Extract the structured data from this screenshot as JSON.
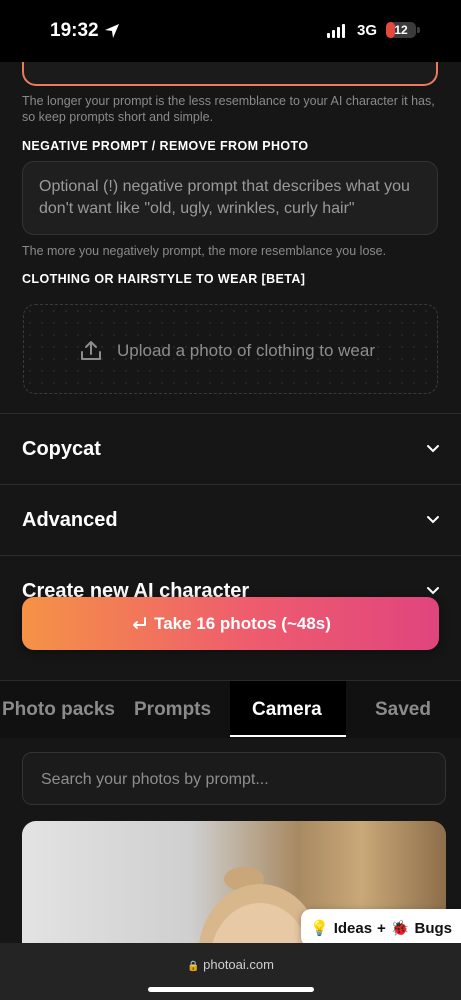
{
  "status_bar": {
    "time": "19:32",
    "network": "3G",
    "battery": "12",
    "battery_fraction": 0.12
  },
  "prompt_hint": "The longer your prompt is the less resemblance to your AI character it has, so keep prompts short and simple.",
  "negative_prompt": {
    "label": "NEGATIVE PROMPT / REMOVE FROM PHOTO",
    "placeholder": "Optional (!) negative prompt that describes what you don't want like \"old, ugly, wrinkles, curly hair\"",
    "hint": "The more you negatively prompt, the more resemblance you lose."
  },
  "clothing": {
    "label": "CLOTHING OR HAIRSTYLE TO WEAR [BETA]",
    "upload_text": "Upload a photo of clothing to wear",
    "icon": "upload-icon"
  },
  "accordions": [
    {
      "title": "Copycat"
    },
    {
      "title": "Advanced"
    },
    {
      "title": "Create new AI character"
    }
  ],
  "cta": {
    "label": "Take 16 photos (~48s)",
    "icon": "return-icon"
  },
  "tabs": [
    {
      "label": "Photo packs",
      "active": false
    },
    {
      "label": "Prompts",
      "active": false
    },
    {
      "label": "Camera",
      "active": true
    },
    {
      "label": "Saved",
      "active": false
    }
  ],
  "search": {
    "placeholder": "Search your photos by prompt..."
  },
  "feedback": {
    "ideas_label": "Ideas",
    "plus": "+",
    "bugs_label": "Bugs"
  },
  "browser": {
    "url": "photoai.com"
  },
  "colors": {
    "accent_start": "#f59246",
    "accent_end": "#e0457e",
    "background": "#161616"
  }
}
